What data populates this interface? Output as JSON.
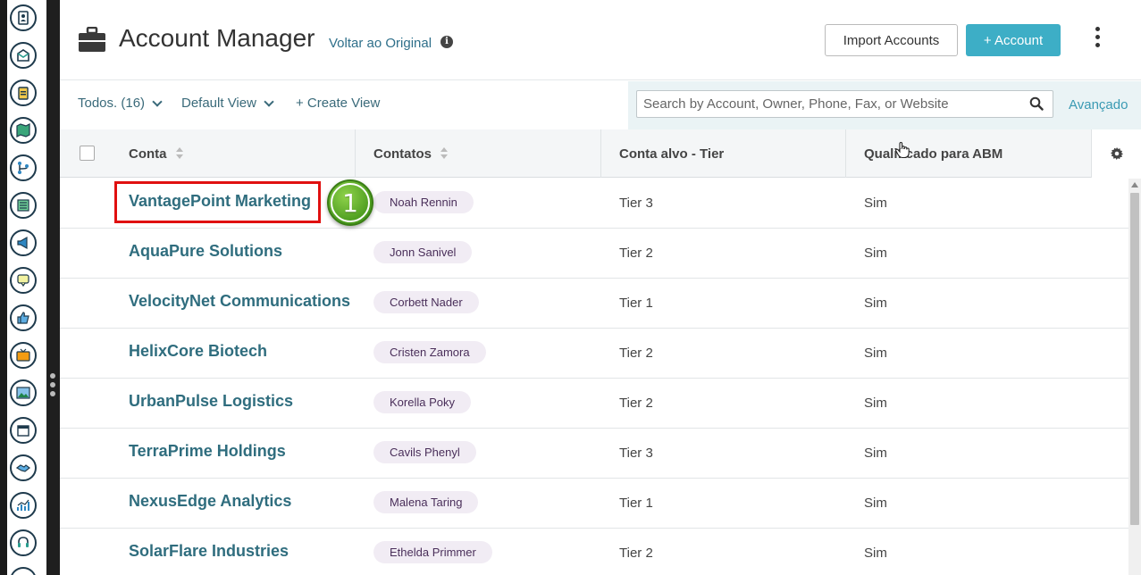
{
  "header": {
    "title": "Account Manager",
    "back_link": "Voltar ao Original",
    "import_button": "Import Accounts",
    "add_button": "+ Account"
  },
  "filters": {
    "all_label": "Todos.",
    "all_count": "(16)",
    "view_label": "Default View",
    "create_view": "+ Create View"
  },
  "search": {
    "placeholder": "Search by Account, Owner, Phone, Fax, or Website",
    "advanced_link": "Avançado"
  },
  "table": {
    "columns": [
      "Conta",
      "Contatos",
      "Conta alvo - Tier",
      "Qualificado para ABM"
    ],
    "rows": [
      {
        "account": "VantagePoint Marketing",
        "contact": "Noah Rennin",
        "tier": "Tier 3",
        "abm": "Sim"
      },
      {
        "account": "AquaPure Solutions",
        "contact": "Jonn Sanivel",
        "tier": "Tier 2",
        "abm": "Sim"
      },
      {
        "account": "VelocityNet Communications",
        "contact": "Corbett Nader",
        "tier": "Tier 1",
        "abm": "Sim"
      },
      {
        "account": "HelixCore Biotech",
        "contact": "Cristen Zamora",
        "tier": "Tier 2",
        "abm": "Sim"
      },
      {
        "account": "UrbanPulse Logistics",
        "contact": "Korella Poky",
        "tier": "Tier 2",
        "abm": "Sim"
      },
      {
        "account": "TerraPrime Holdings",
        "contact": "Cavils Phenyl",
        "tier": "Tier 3",
        "abm": "Sim"
      },
      {
        "account": "NexusEdge Analytics",
        "contact": "Malena Taring",
        "tier": "Tier 1",
        "abm": "Sim"
      },
      {
        "account": "SolarFlare Industries",
        "contact": "Ethelda Primmer",
        "tier": "Tier 2",
        "abm": "Sim"
      }
    ]
  },
  "annotation": {
    "step_number": "1"
  },
  "rail_icons": [
    "contacts-icon",
    "mail-icon",
    "clipboard-icon",
    "map-icon",
    "branch-icon",
    "list-icon",
    "megaphone-icon",
    "chat-icon",
    "thumbs-up-icon",
    "tv-icon",
    "image-icon",
    "calendar-icon",
    "handshake-icon",
    "analytics-icon",
    "headset-icon"
  ],
  "colors": {
    "accent": "#3daec6",
    "link": "#2f6d7e",
    "highlight": "#e01010",
    "step_badge": "#5aa82a"
  }
}
